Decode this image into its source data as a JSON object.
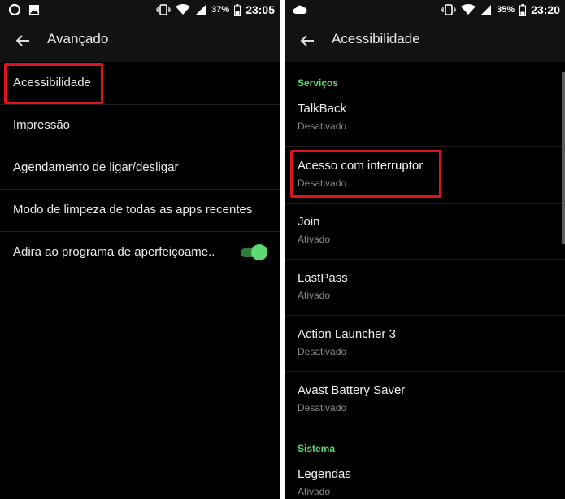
{
  "left": {
    "status": {
      "battery_pct": "37%",
      "time": "23:05"
    },
    "title": "Avançado",
    "items": [
      {
        "label": "Acessibilidade"
      },
      {
        "label": "Impressão"
      },
      {
        "label": "Agendamento de ligar/desligar"
      },
      {
        "label": "Modo de limpeza de todas as apps recentes"
      },
      {
        "label": "Adira ao programa de aperfeiçoame..",
        "toggle_on": true
      }
    ]
  },
  "right": {
    "status": {
      "battery_pct": "35%",
      "time": "23:20"
    },
    "title": "Acessibilidade",
    "sections": [
      {
        "label": "Serviços"
      },
      {
        "label": "Sistema"
      }
    ],
    "services": [
      {
        "title": "TalkBack",
        "status": "Desativado"
      },
      {
        "title": "Acesso com interruptor",
        "status": "Desativado"
      },
      {
        "title": "Join",
        "status": "Ativado"
      },
      {
        "title": "LastPass",
        "status": "Ativado"
      },
      {
        "title": "Action Launcher 3",
        "status": "Desativado"
      },
      {
        "title": "Avast Battery Saver",
        "status": "Desativado"
      }
    ],
    "system": [
      {
        "title": "Legendas",
        "status": "Ativado"
      }
    ]
  },
  "colors": {
    "highlight": "#e0141e",
    "accent_green": "#5cdc70",
    "background": "#000000"
  }
}
